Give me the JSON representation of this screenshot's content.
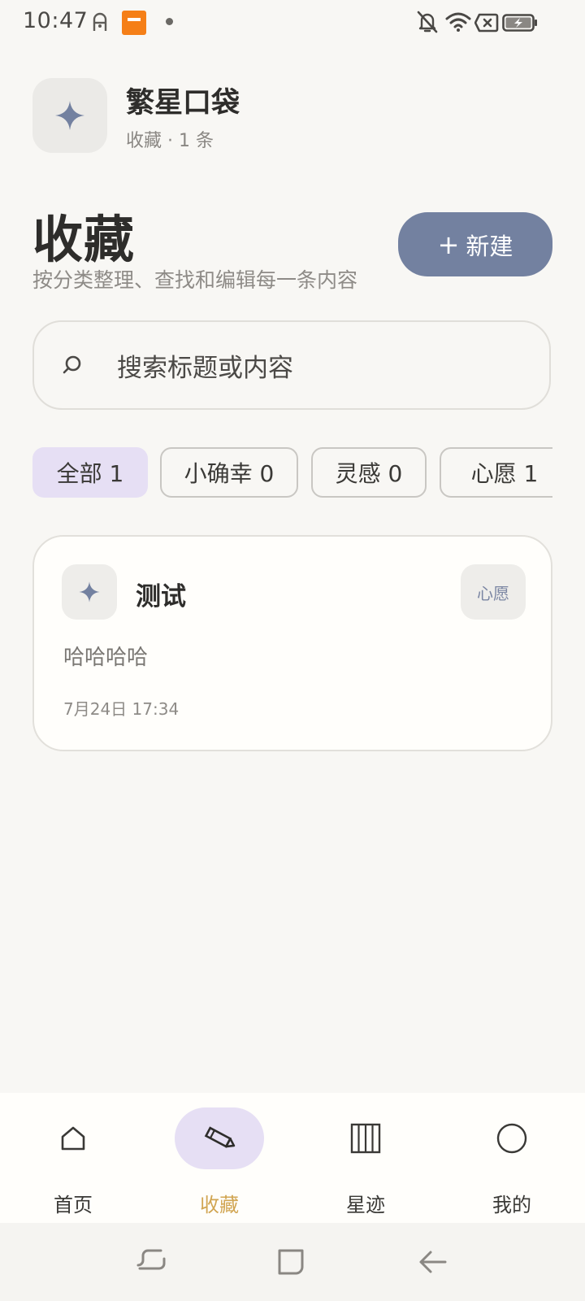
{
  "status_bar": {
    "time": "10:47",
    "icons": [
      "ghost-notification-icon",
      "orange-app-icon",
      "dot-icon",
      "bell-off-icon",
      "wifi-icon",
      "no-sim-icon",
      "battery-charging-icon"
    ]
  },
  "header": {
    "app_name": "繁星口袋",
    "subtitle": "收藏 · 1 条",
    "logo_icon": "sparkle-icon"
  },
  "page": {
    "title": "收藏",
    "description": "按分类整理、查找和编辑每一条内容",
    "new_button_label": "新建",
    "new_button_icon": "plus-icon"
  },
  "search": {
    "placeholder": "搜索标题或内容"
  },
  "filters": [
    {
      "label": "全部 1",
      "active": true
    },
    {
      "label": "小确幸 0",
      "active": false
    },
    {
      "label": "灵感 0",
      "active": false
    },
    {
      "label": "心愿 1",
      "active": false
    }
  ],
  "items": [
    {
      "title": "测试",
      "category": "心愿",
      "content": "哈哈哈哈",
      "time": "7月24日 17:34",
      "icon": "sparkle-icon"
    }
  ],
  "bottom_nav": [
    {
      "label": "首页",
      "icon": "home-icon",
      "active": false
    },
    {
      "label": "收藏",
      "icon": "pencil-icon",
      "active": true
    },
    {
      "label": "星迹",
      "icon": "columns-icon",
      "active": false
    },
    {
      "label": "我的",
      "icon": "circle-icon",
      "active": false
    }
  ],
  "colors": {
    "accent": "#7381a0",
    "chip_active": "#e6dff4",
    "nav_active_label": "#d1a552",
    "background": "#f8f7f4"
  }
}
